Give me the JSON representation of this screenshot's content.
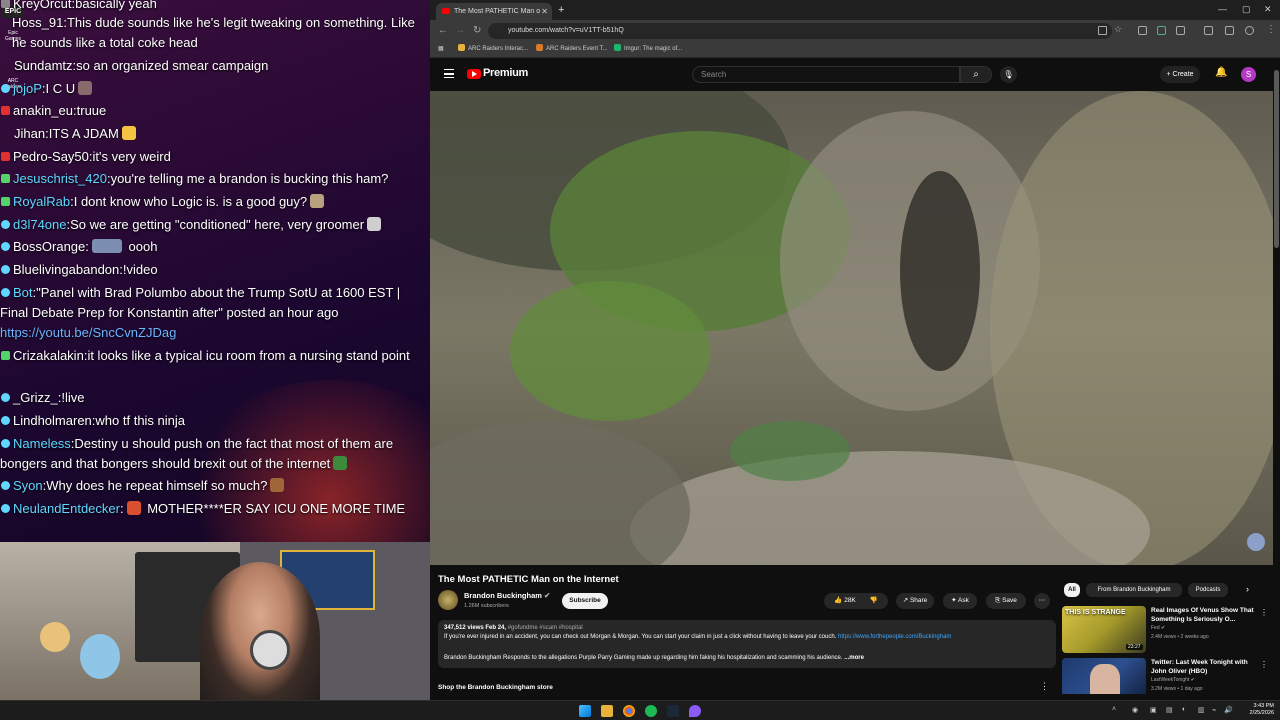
{
  "chat": {
    "messages": [
      {
        "user": "KreyOrcut",
        "text": "basically yeah",
        "user_color": "#ffffff",
        "badge_color": "#888888"
      },
      {
        "user": "Hoss_91",
        "text": "This dude sounds like he's legit tweaking on something. Like he sounds like a total coke head",
        "user_color": "#ffffff",
        "badge_color": "#888888"
      },
      {
        "user": "Sundamtz",
        "text": "so an organized smear campaign",
        "user_color": "#ffffff",
        "badge_color": "#888888"
      },
      {
        "user": "jojoP",
        "text": "I C U",
        "user_color": "#5fd7ff",
        "badge_color": "#55d36b"
      },
      {
        "user": "anakin_eu",
        "text": "truue",
        "user_color": "#ffffff",
        "badge_color": "#e23030"
      },
      {
        "user": "Jihan",
        "text": "ITS A JDAM",
        "user_color": "#ffffff",
        "badge_color": "#888888"
      },
      {
        "user": "Pedro-Say50",
        "text": "it's very weird",
        "user_color": "#ffffff",
        "badge_color": "#e23030"
      },
      {
        "user": "Jesuschrist_420",
        "text": "you're telling me a brandon is bucking this ham?",
        "user_color": "#5fd7ff",
        "badge_color": "#55d36b"
      },
      {
        "user": "RoyalRab",
        "text": "I dont know who  Logic is. is  a good guy?",
        "user_color": "#5fd7ff",
        "badge_color": "#55d36b"
      },
      {
        "user": "d3l74one",
        "text": "So we are getting \"conditioned\" here, very groomer",
        "user_color": "#5fd7ff",
        "badge_color": "#5fd7ff"
      },
      {
        "user": "BossOrange",
        "text": " oooh",
        "user_color": "#ffffff",
        "badge_color": "#5fd7ff"
      },
      {
        "user": "Bluelivingabandon",
        "text": "!video",
        "user_color": "#ffffff",
        "badge_color": "#5fd7ff"
      },
      {
        "user": "Bot",
        "text": "\"Panel with Brad Polumbo about the Trump SotU at 1600 EST | Final Debate Prep for Konstantin after\" posted an hour ago",
        "user_color": "#5fd7ff",
        "badge_color": "#5fd7ff"
      },
      {
        "user": "",
        "text": "https://youtu.be/SncCvnZJDag",
        "user_color": "#6cb4ff",
        "badge_color": ""
      },
      {
        "user": "Crizakalakin",
        "text": "it looks like a typical icu room from a nursing stand point",
        "user_color": "#ffffff",
        "badge_color": "#55d36b"
      },
      {
        "user": "_Grizz_",
        "text": "!live",
        "user_color": "#ffffff",
        "badge_color": "#5fd7ff"
      },
      {
        "user": "Lindholmaren",
        "text": "who tf this ninja",
        "user_color": "#ffffff",
        "badge_color": "#5fd7ff"
      },
      {
        "user": "Nameless",
        "text": "Destiny u should push on the fact that most of them are bongers and that bongers should brexit out of the internet",
        "user_color": "#5fd7ff",
        "badge_color": "#5fd7ff"
      },
      {
        "user": "Syon",
        "text": "Why does he repeat himself so much?",
        "user_color": "#5fd7ff",
        "badge_color": "#5fd7ff"
      },
      {
        "user": "NeulandEntdecker",
        "text": " MOTHER****ER SAY ICU ONE MORE TIME",
        "user_color": "#5fd7ff",
        "badge_color": "#5fd7ff"
      }
    ],
    "side_icons": [
      "EPIC",
      "Epic Games",
      "ARC Raiders"
    ]
  },
  "browser": {
    "tab_title": "The Most PATHETIC Man o",
    "url": "youtube.com/watch?v=uV1TT-b51hQ",
    "bookmarks": [
      "ARC Raiders Interac...",
      "ARC Raiders Event T...",
      "Imgur: The magic of..."
    ],
    "bookmark_colors": [
      "#e8b33a",
      "#d97a2b",
      "#1bb76e"
    ]
  },
  "youtube": {
    "logo_text": "Premium",
    "search_placeholder": "Search",
    "create_label": "Create",
    "avatar_letter": "S",
    "video_title": "The Most PATHETIC Man on the Internet",
    "channel_name": "Brandon Buckingham",
    "channel_subs": "1.26M subscribers",
    "subscribe_label": "Subscribe",
    "like_count": "28K",
    "share_label": "Share",
    "ask_label": "Ask",
    "save_label": "Save",
    "views_date": "347,512 views  Feb 24,",
    "hashtags": "#gofundme #scam #hospital",
    "desc_line1": "If you're ever injured in an accident, you can check out Morgan & Morgan. You can start your claim in just a click without having to leave your couch.",
    "desc_link": "https://www.forthepeople.com/Buckingham",
    "desc_line2": "Brandon Buckingham Responds to the allegations Purple Parry Gaming made up regarding him faking his hospitalization and scamming his audience.",
    "more_label": "...more",
    "shop_label": "Shop the Brandon Buckingham store",
    "chips": [
      "All",
      "From Brandon Buckingham",
      "Podcasts"
    ],
    "recommendations": [
      {
        "title": "Real Images Of Venus Show That Something Is Seriously O...",
        "channel": "Fed",
        "meta": "2.4M views • 2 weeks ago",
        "duration": "23:27",
        "thumb_text": "THIS IS STRANGE"
      },
      {
        "title": "Twitter: Last Week Tonight with John Oliver (HBO)",
        "channel": "LastWeekTonight",
        "meta": "3.2M views • 1 day ago",
        "duration": "",
        "thumb_text": ""
      }
    ]
  },
  "taskbar": {
    "time": "3:43 PM",
    "date": "2/25/2026"
  }
}
